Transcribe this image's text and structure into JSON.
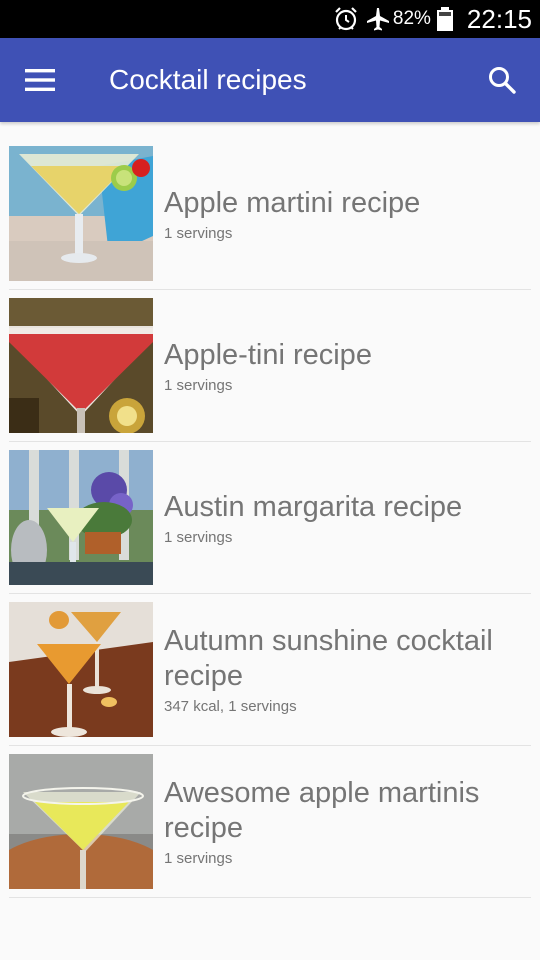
{
  "status_bar": {
    "battery_percent": "82%",
    "time": "22:15",
    "icons": [
      "alarm-icon",
      "airplane-mode-icon",
      "battery-icon"
    ]
  },
  "app_bar": {
    "title": "Cocktail recipes",
    "menu_icon": "menu-icon",
    "search_icon": "search-icon",
    "color": "#3f51b5"
  },
  "recipes": [
    {
      "name": "Apple martini recipe",
      "meta": "1 servings"
    },
    {
      "name": "Apple-tini recipe",
      "meta": "1 servings"
    },
    {
      "name": "Austin margarita  recipe",
      "meta": "1 servings"
    },
    {
      "name": "Autumn sunshine cocktail recipe",
      "meta": "347 kcal, 1 servings"
    },
    {
      "name": "Awesome apple martinis recipe",
      "meta": "1 servings"
    }
  ]
}
